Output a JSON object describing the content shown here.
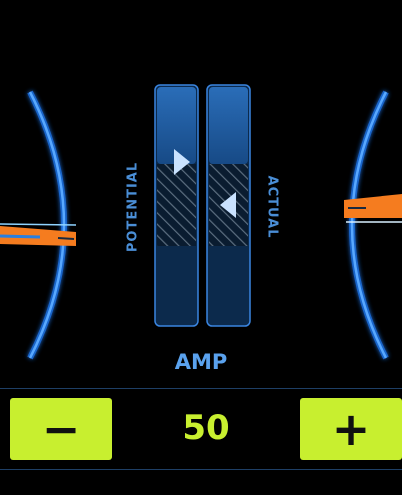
{
  "meter": {
    "left_label": "POTENTIAL",
    "right_label": "ACTUAL",
    "unit_label": "AMP"
  },
  "control": {
    "decrease_label": "−",
    "increase_label": "+",
    "value": "50"
  },
  "colors": {
    "background": "#000000",
    "accent_blue": "#3a8cff",
    "panel_blue": "#1f5a99",
    "needle_orange": "#f57c1f",
    "button_lime": "#c8ef2f"
  },
  "icons": {
    "potential_marker": "triangle-right-icon",
    "actual_marker": "triangle-left-icon"
  }
}
